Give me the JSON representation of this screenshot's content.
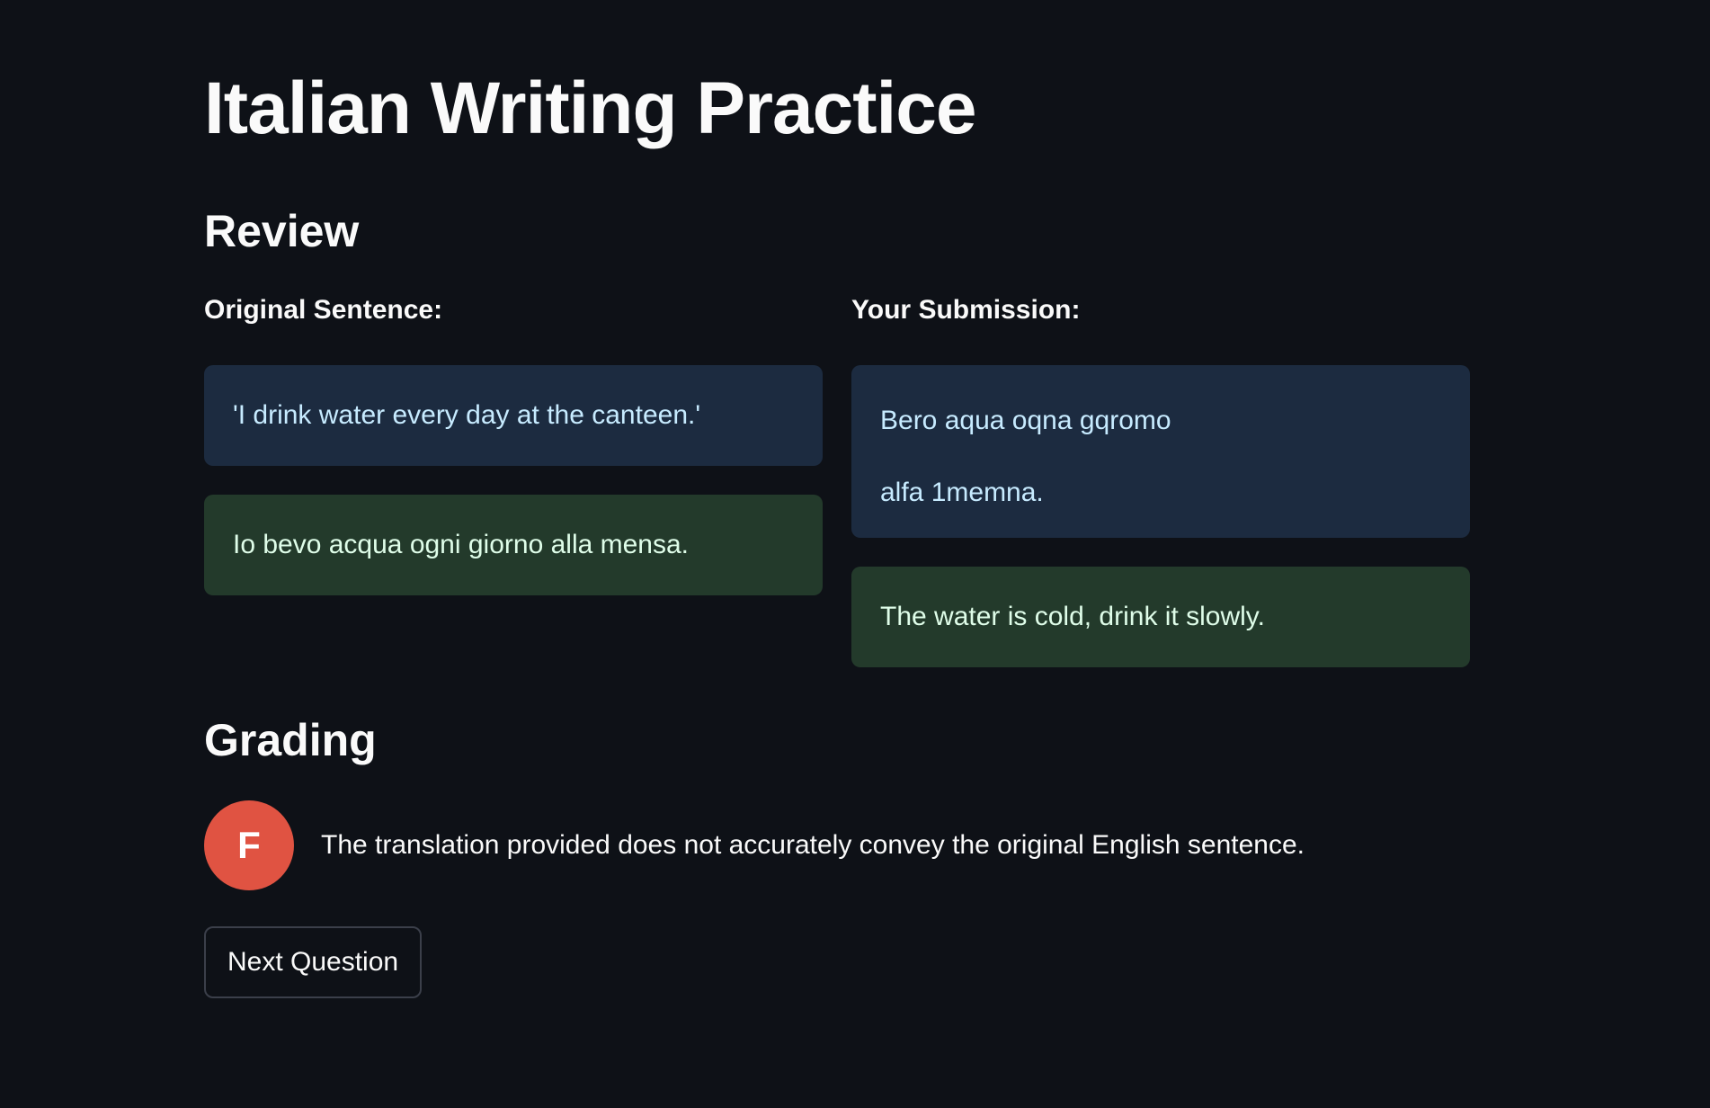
{
  "page": {
    "title": "Italian Writing Practice"
  },
  "review": {
    "heading": "Review",
    "original": {
      "label": "Original Sentence:",
      "english": "'I drink water every day at the canteen.'",
      "italian": "Io bevo acqua ogni giorno alla mensa."
    },
    "submission": {
      "label": "Your Submission:",
      "text_line_1": "Bero aqua oqna gqromo",
      "text_line_2": "alfa 1memna.",
      "translation": "The water is cold, drink it slowly."
    }
  },
  "grading": {
    "heading": "Grading",
    "grade": "F",
    "feedback": "The translation provided does not accurately convey the original English sentence.",
    "badge_color": "#e05342"
  },
  "actions": {
    "next_label": "Next Question"
  },
  "colors": {
    "background": "#0e1117",
    "info_box": "#1c2b40",
    "success_box": "#233a2b"
  }
}
